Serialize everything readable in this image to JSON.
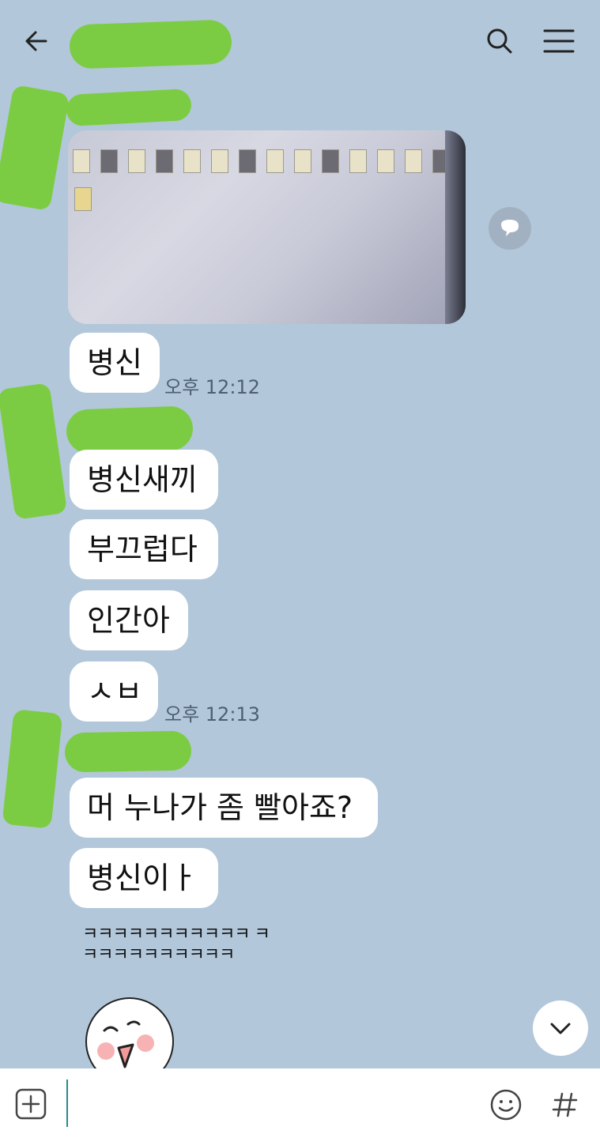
{
  "header": {
    "back_icon": "arrow-left-icon",
    "search_icon": "search-icon",
    "menu_icon": "hamburger-menu-icon"
  },
  "messages": [
    {
      "id": "m1",
      "type": "image"
    },
    {
      "id": "m2",
      "text": "병신",
      "time": "오후 12:12"
    },
    {
      "id": "m3",
      "text": "병신새끼"
    },
    {
      "id": "m4",
      "text": "부끄럽다"
    },
    {
      "id": "m5",
      "text": "인간아"
    },
    {
      "id": "m6",
      "text": "ㅅㅂ",
      "time": "오후 12:13"
    },
    {
      "id": "m7",
      "text": "머 누나가 좀 빨아죠?"
    },
    {
      "id": "m8",
      "text": "병신이ㅏ"
    },
    {
      "id": "m9",
      "text": "ㅋㅋㅋㅋㅋㅋㅋㅋㅋㅋㅋ ㅋㅋㅋㅋㅋㅋㅋㅋㅋㅋㅋ"
    }
  ],
  "sticker": {
    "icon": "smiling-face-sticker-icon"
  },
  "overlay": {
    "share_icon": "speech-bubble-share-icon",
    "scroll_icon": "chevron-down-icon"
  },
  "input_bar": {
    "plus_icon": "plus-square-icon",
    "emoji_icon": "emoji-smile-icon",
    "hash_icon": "hash-icon",
    "value": ""
  },
  "colors": {
    "background": "#b2c7da",
    "bubble": "#ffffff",
    "redaction": "#79cc3b"
  }
}
